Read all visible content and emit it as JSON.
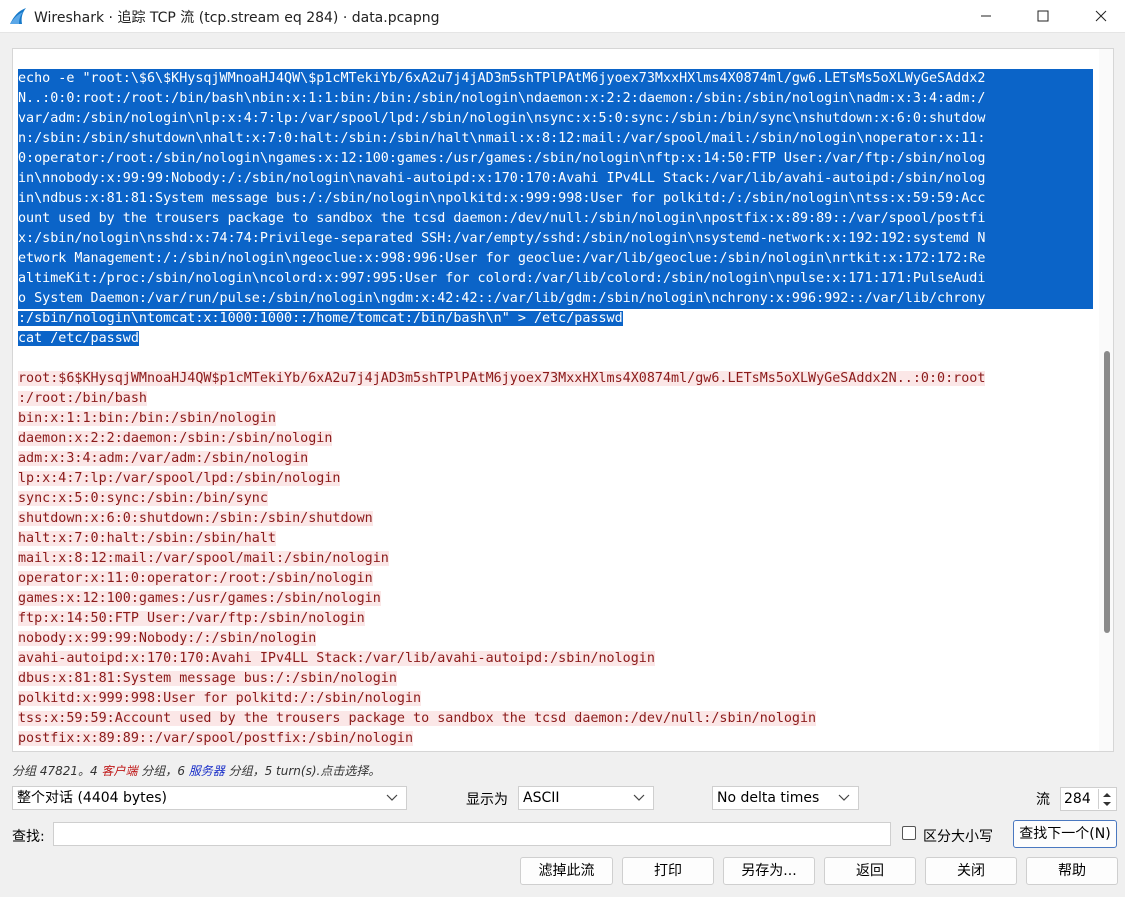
{
  "window": {
    "title": "Wireshark · 追踪 TCP 流 (tcp.stream eq 284) · data.pcapng",
    "icons": [
      "wireshark-fin-icon",
      "minimize-icon",
      "maximize-icon",
      "close-icon"
    ]
  },
  "stream": {
    "client_lines": [
      "echo -e \"root:\\$6\\$KHysqjWMnoaHJ4QW\\$p1cMTekiYb/6xA2u7j4jAD3m5shTPlPAtM6jyoex73MxxHXlms4X0874ml/gw6.LETsMs5oXLWyGeSAddx2",
      "N..:0:0:root:/root:/bin/bash\\nbin:x:1:1:bin:/bin:/sbin/nologin\\ndaemon:x:2:2:daemon:/sbin:/sbin/nologin\\nadm:x:3:4:adm:/",
      "var/adm:/sbin/nologin\\nlp:x:4:7:lp:/var/spool/lpd:/sbin/nologin\\nsync:x:5:0:sync:/sbin:/bin/sync\\nshutdown:x:6:0:shutdow",
      "n:/sbin:/sbin/shutdown\\nhalt:x:7:0:halt:/sbin:/sbin/halt\\nmail:x:8:12:mail:/var/spool/mail:/sbin/nologin\\noperator:x:11:",
      "0:operator:/root:/sbin/nologin\\ngames:x:12:100:games:/usr/games:/sbin/nologin\\nftp:x:14:50:FTP User:/var/ftp:/sbin/nolog",
      "in\\nnobody:x:99:99:Nobody:/:/sbin/nologin\\navahi-autoipd:x:170:170:Avahi IPv4LL Stack:/var/lib/avahi-autoipd:/sbin/nolog",
      "in\\ndbus:x:81:81:System message bus:/:/sbin/nologin\\npolkitd:x:999:998:User for polkitd:/:/sbin/nologin\\ntss:x:59:59:Acc",
      "ount used by the trousers package to sandbox the tcsd daemon:/dev/null:/sbin/nologin\\npostfix:x:89:89::/var/spool/postfi",
      "x:/sbin/nologin\\nsshd:x:74:74:Privilege-separated SSH:/var/empty/sshd:/sbin/nologin\\nsystemd-network:x:192:192:systemd N",
      "etwork Management:/:/sbin/nologin\\ngeoclue:x:998:996:User for geoclue:/var/lib/geoclue:/sbin/nologin\\nrtkit:x:172:172:Re",
      "altimeKit:/proc:/sbin/nologin\\ncolord:x:997:995:User for colord:/var/lib/colord:/sbin/nologin\\npulse:x:171:171:PulseAudi",
      "o System Daemon:/var/run/pulse:/sbin/nologin\\ngdm:x:42:42::/var/lib/gdm:/sbin/nologin\\nchrony:x:996:992::/var/lib/chrony",
      ":/sbin/nologin\\ntomcat:x:1000:1000::/home/tomcat:/bin/bash\\n\" > /etc/passwd",
      "cat /etc/passwd"
    ],
    "server_lines": [
      "root:$6$KHysqjWMnoaHJ4QW$p1cMTekiYb/6xA2u7j4jAD3m5shTPlPAtM6jyoex73MxxHXlms4X0874ml/gw6.LETsMs5oXLWyGeSAddx2N..:0:0:root",
      ":/root:/bin/bash",
      "bin:x:1:1:bin:/bin:/sbin/nologin",
      "daemon:x:2:2:daemon:/sbin:/sbin/nologin",
      "adm:x:3:4:adm:/var/adm:/sbin/nologin",
      "lp:x:4:7:lp:/var/spool/lpd:/sbin/nologin",
      "sync:x:5:0:sync:/sbin:/bin/sync",
      "shutdown:x:6:0:shutdown:/sbin:/sbin/shutdown",
      "halt:x:7:0:halt:/sbin:/sbin/halt",
      "mail:x:8:12:mail:/var/spool/mail:/sbin/nologin",
      "operator:x:11:0:operator:/root:/sbin/nologin",
      "games:x:12:100:games:/usr/games:/sbin/nologin",
      "ftp:x:14:50:FTP User:/var/ftp:/sbin/nologin",
      "nobody:x:99:99:Nobody:/:/sbin/nologin",
      "avahi-autoipd:x:170:170:Avahi IPv4LL Stack:/var/lib/avahi-autoipd:/sbin/nologin",
      "dbus:x:81:81:System message bus:/:/sbin/nologin",
      "polkitd:x:999:998:User for polkitd:/:/sbin/nologin",
      "tss:x:59:59:Account used by the trousers package to sandbox the tcsd daemon:/dev/null:/sbin/nologin",
      "postfix:x:89:89::/var/spool/postfix:/sbin/nologin"
    ],
    "colors": {
      "selection_bg": "#0b64c8",
      "client_text": "#000080",
      "server_text": "#8b1a1a",
      "server_bg": "#fbe7e7"
    }
  },
  "status": {
    "prefix": "分组 47821。",
    "client_count": "4",
    "client_word": "客户端",
    "client_suffix": " 分组，",
    "server_count": "6",
    "server_word": "服务器",
    "server_suffix": " 分组，5 turn(s).点击选择。"
  },
  "controls": {
    "conversation_select": "整个对话 (4404 bytes)",
    "show_as_label": "显示为",
    "show_as_value": "ASCII",
    "delta_value": "No delta times",
    "stream_label": "流",
    "stream_value": "284"
  },
  "find": {
    "label": "查找:",
    "value": "",
    "case_label": "区分大小写",
    "case_checked": false,
    "find_next": "查找下一个(N)"
  },
  "buttons": {
    "filter_out": "滤掉此流",
    "print": "打印",
    "save_as": "另存为...",
    "back": "返回",
    "close": "关闭",
    "help": "帮助"
  }
}
